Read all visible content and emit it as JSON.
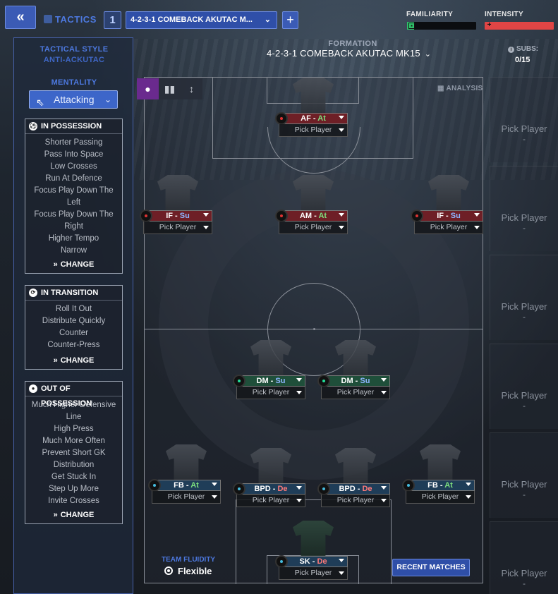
{
  "header": {
    "back_label": "«",
    "tactics_label": "TACTICS",
    "slot_number": "1",
    "tactic_name": "4-2-3-1 COMEBACK AKUTAC M...",
    "add_label": "+",
    "familiarity_label": "FAMILIARITY",
    "familiarity_level": 0.1,
    "intensity_label": "INTENSITY",
    "intensity_level": 1.0
  },
  "sidebar": {
    "tactical_style_label": "TACTICAL STYLE",
    "tactical_style_value": "ANTI-ACKUTAC",
    "mentality_label": "MENTALITY",
    "mentality_value": "Attacking",
    "in_possession": {
      "title": "IN POSSESSION",
      "items": [
        "Shorter Passing",
        "Pass Into Space",
        "Low Crosses",
        "Run At Defence",
        "Focus Play Down The Left",
        "Focus Play Down The Right",
        "Higher Tempo",
        "Narrow"
      ],
      "change_label": "CHANGE"
    },
    "in_transition": {
      "title": "IN TRANSITION",
      "items": [
        "Roll It Out",
        "Distribute Quickly",
        "Counter",
        "Counter-Press"
      ],
      "change_label": "CHANGE"
    },
    "out_of_possession": {
      "title": "OUT OF POSSESSION",
      "items": [
        "Much Higher Defensive Line",
        "High Press",
        "Much More Often",
        "Prevent Short GK Distribution",
        "Get Stuck In",
        "Step Up More",
        "Invite Crosses"
      ],
      "change_label": "CHANGE"
    }
  },
  "formation": {
    "label": "FORMATION",
    "value": "4-2-3-1 COMEBACK AKUTAC MK15",
    "subs_label": "SUBS:",
    "subs_value": "0/15",
    "analysis_label": "ANALYSIS"
  },
  "players": [
    {
      "id": "af",
      "role": "AF",
      "duty": "At",
      "pick": "Pick Player",
      "line": "att"
    },
    {
      "id": "if-l",
      "role": "IF",
      "duty": "Su",
      "pick": "Pick Player",
      "line": "att"
    },
    {
      "id": "am",
      "role": "AM",
      "duty": "At",
      "pick": "Pick Player",
      "line": "att"
    },
    {
      "id": "if-r",
      "role": "IF",
      "duty": "Su",
      "pick": "Pick Player",
      "line": "att"
    },
    {
      "id": "dm-l",
      "role": "DM",
      "duty": "Su",
      "pick": "Pick Player",
      "line": "mid"
    },
    {
      "id": "dm-r",
      "role": "DM",
      "duty": "Su",
      "pick": "Pick Player",
      "line": "mid"
    },
    {
      "id": "fb-l",
      "role": "FB",
      "duty": "At",
      "pick": "Pick Player",
      "line": "def"
    },
    {
      "id": "bpd-l",
      "role": "BPD",
      "duty": "De",
      "pick": "Pick Player",
      "line": "def"
    },
    {
      "id": "bpd-r",
      "role": "BPD",
      "duty": "De",
      "pick": "Pick Player",
      "line": "def"
    },
    {
      "id": "fb-r",
      "role": "FB",
      "duty": "At",
      "pick": "Pick Player",
      "line": "def"
    },
    {
      "id": "sk",
      "role": "SK",
      "duty": "De",
      "pick": "Pick Player",
      "line": "def"
    }
  ],
  "subs": [
    {
      "label": "Pick Player",
      "value": "-"
    },
    {
      "label": "Pick Player",
      "value": "-"
    },
    {
      "label": "Pick Player",
      "value": "-"
    },
    {
      "label": "Pick Player",
      "value": "-"
    },
    {
      "label": "Pick Player",
      "value": "-"
    },
    {
      "label": "Pick Player",
      "value": "-"
    }
  ],
  "team_fluidity": {
    "label": "TEAM FLUIDITY",
    "value": "Flexible"
  },
  "recent_matches_label": "RECENT MATCHES",
  "icons": {
    "back": "double-chevron-left-icon",
    "tactics": "tactics-board-icon",
    "mentality": "arrow-up-left-icon",
    "in_possession": "ball-icon",
    "in_transition": "transition-icon",
    "out_of_possession": "circle-icon",
    "change": "double-chevron-right-icon",
    "view_player": "player-icon",
    "view_stats": "bar-chart-icon",
    "view_positions": "position-arrows-icon",
    "analysis": "grid-icon",
    "subs_info": "info-icon"
  },
  "colors": {
    "accent_blue": "#3b5bb5",
    "attack_role": "#6e1f26",
    "midfield_role": "#1f4f3a",
    "defence_role": "#1f3d58",
    "familiarity_fill": "#2fbf6a",
    "intensity_fill": "#e04545",
    "active_view_tab": "#6a2a8e"
  }
}
